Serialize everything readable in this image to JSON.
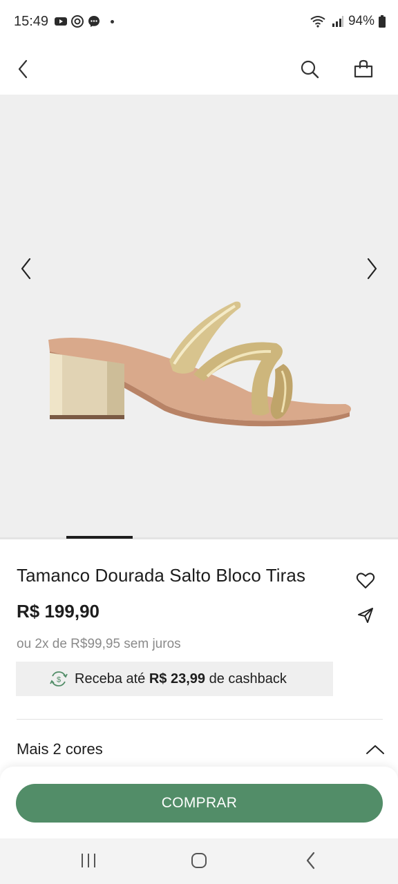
{
  "status_bar": {
    "time": "15:49",
    "battery": "94%",
    "icons": [
      "youtube-icon",
      "threads-icon",
      "messenger-icon",
      "wifi-icon",
      "signal-icon",
      "battery-icon"
    ]
  },
  "app_bar": {
    "icons": [
      "back-arrow-icon",
      "search-icon",
      "shopping-bag-icon"
    ]
  },
  "product": {
    "title": "Tamanco Dourada Salto Bloco Tiras",
    "price": "R$ 199,90",
    "installments": "ou 2x de R$99,95 sem juros",
    "cashback": {
      "prefix": "Receba até",
      "amount": "R$ 23,99",
      "suffix": "de cashback"
    },
    "more_colors_label": "Mais 2 cores"
  },
  "actions": {
    "buy_label": "COMPRAR"
  },
  "colors": {
    "accent": "#528d68",
    "image_background": "#efefef",
    "text": "#1d1d1d",
    "muted_text": "#8a8a8a"
  }
}
